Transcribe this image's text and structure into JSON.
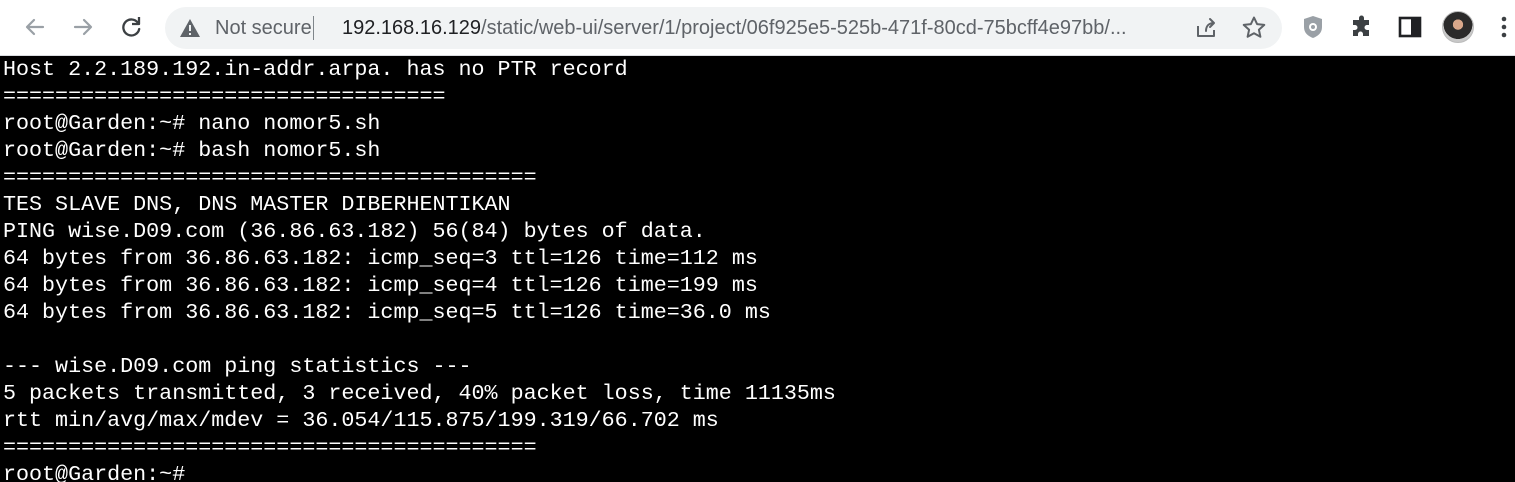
{
  "browser": {
    "security_label": "Not secure",
    "url_host": "192.168.16.129",
    "url_path": "/static/web-ui/server/1/project/06f925e5-525b-471f-80cd-75bcff4e97bb/...",
    "icons": {
      "back": "back-arrow-icon",
      "forward": "forward-arrow-icon",
      "reload": "reload-icon",
      "warning": "warning-triangle-icon",
      "share": "share-icon",
      "bookmark": "star-icon",
      "extension_shield": "shield-icon",
      "extensions": "puzzle-icon",
      "side_panel": "side-panel-icon",
      "menu": "three-dots-menu-icon"
    }
  },
  "terminal": {
    "lines": [
      "Host 2.2.189.192.in-addr.arpa. has no PTR record",
      "==================================",
      "root@Garden:~# nano nomor5.sh",
      "root@Garden:~# bash nomor5.sh",
      "=========================================",
      "TES SLAVE DNS, DNS MASTER DIBERHENTIKAN",
      "PING wise.D09.com (36.86.63.182) 56(84) bytes of data.",
      "64 bytes from 36.86.63.182: icmp_seq=3 ttl=126 time=112 ms",
      "64 bytes from 36.86.63.182: icmp_seq=4 ttl=126 time=199 ms",
      "64 bytes from 36.86.63.182: icmp_seq=5 ttl=126 time=36.0 ms",
      "",
      "--- wise.D09.com ping statistics ---",
      "5 packets transmitted, 3 received, 40% packet loss, time 11135ms",
      "rtt min/avg/max/mdev = 36.054/115.875/199.319/66.702 ms",
      "=========================================",
      "root@Garden:~#"
    ]
  },
  "colors": {
    "terminal_bg": "#000000",
    "terminal_fg": "#ffffff",
    "toolbar_bg": "#ffffff",
    "omnibox_bg": "#f1f3f4"
  }
}
